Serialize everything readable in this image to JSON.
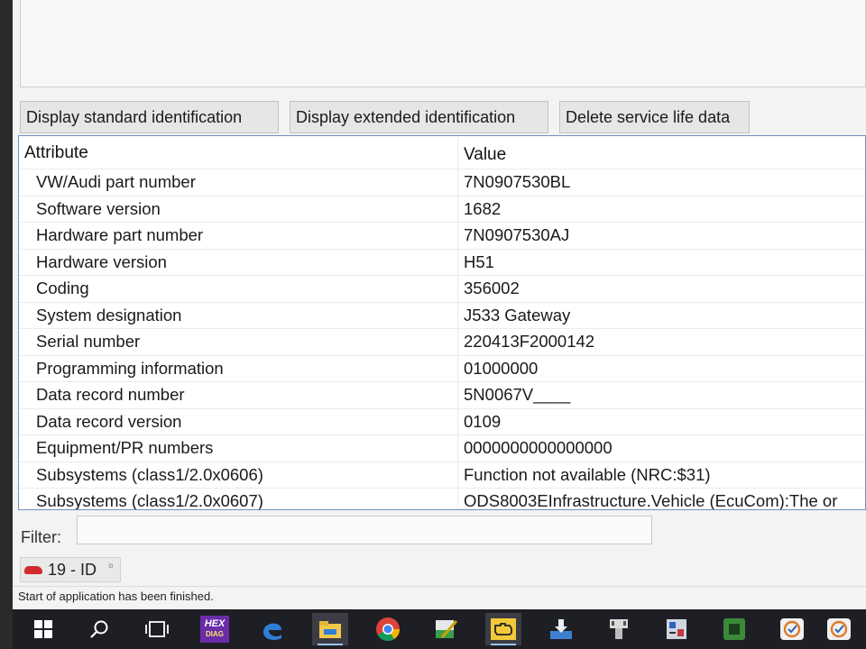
{
  "toolbar": {
    "btn_standard": "Display standard identification",
    "btn_extended": "Display extended identification",
    "btn_delete": "Delete service life data"
  },
  "table": {
    "col_attribute": "Attribute",
    "col_value": "Value",
    "rows": [
      {
        "attr": "VW/Audi part number",
        "value": "7N0907530BL"
      },
      {
        "attr": "Software version",
        "value": "1682"
      },
      {
        "attr": "Hardware part number",
        "value": "7N0907530AJ"
      },
      {
        "attr": "Hardware version",
        "value": "H51"
      },
      {
        "attr": "Coding",
        "value": "356002"
      },
      {
        "attr": "System designation",
        "value": "J533  Gateway"
      },
      {
        "attr": "Serial number",
        "value": "220413F2000142"
      },
      {
        "attr": "Programming information",
        "value": "01000000"
      },
      {
        "attr": "Data record number",
        "value": "5N0067V____"
      },
      {
        "attr": "Data record version",
        "value": "0109"
      },
      {
        "attr": "Equipment/PR numbers",
        "value": "0000000000000000"
      },
      {
        "attr": "Subsystems (class1/2.0x0606)",
        "value": "Function not available (NRC:$31)"
      },
      {
        "attr": "Subsystems (class1/2.0x0607)",
        "value": "ODS8003EInfrastructure.Vehicle (EcuCom):The or"
      }
    ]
  },
  "filter": {
    "label": "Filter:",
    "value": ""
  },
  "tab": {
    "label": "19 - ID",
    "close": "¤"
  },
  "status": {
    "text": "Start of application has been finished."
  },
  "taskbar": {
    "hex_line1": "HEX",
    "hex_line2": "DIAG"
  }
}
